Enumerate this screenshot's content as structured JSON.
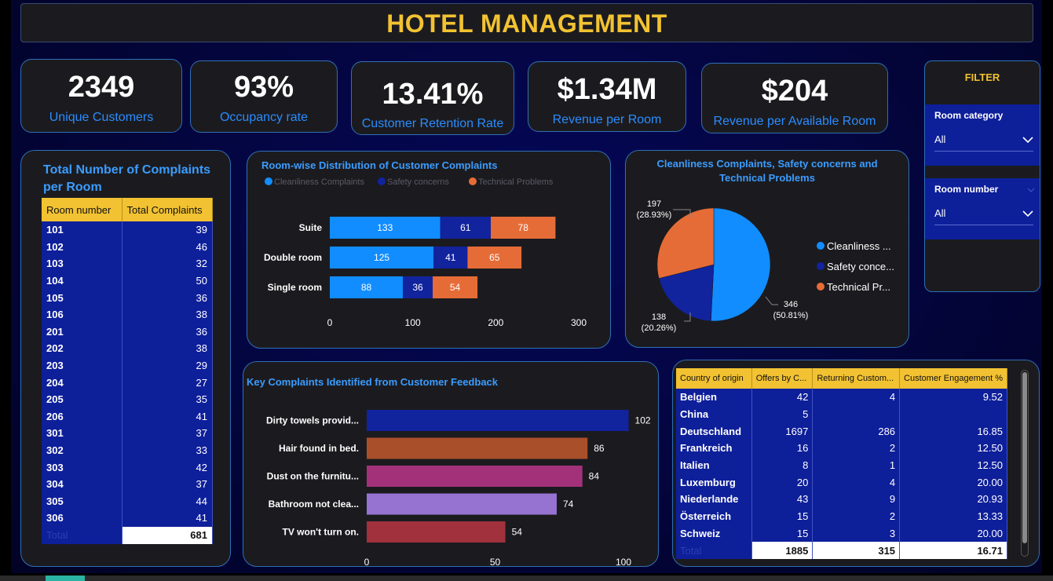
{
  "header": {
    "title": "HOTEL MANAGEMENT"
  },
  "kpis": [
    {
      "value": "2349",
      "label": "Unique Customers"
    },
    {
      "value": "93%",
      "label": "Occupancy rate"
    },
    {
      "value": "13.41%",
      "label": "Customer Retention Rate"
    },
    {
      "value": "$1.34M",
      "label": "Revenue per Room"
    },
    {
      "value": "$204",
      "label": "Revenue per Available Room"
    }
  ],
  "filter": {
    "title": "FILTER",
    "room_category": {
      "label": "Room category",
      "value": "All"
    },
    "room_number": {
      "label": "Room number",
      "value": "All"
    }
  },
  "complaints_table": {
    "title": "Total Number of Complaints per Room",
    "headers": [
      "Room number",
      "Total Complaints"
    ],
    "rows": [
      [
        "101",
        "39"
      ],
      [
        "102",
        "46"
      ],
      [
        "103",
        "32"
      ],
      [
        "104",
        "50"
      ],
      [
        "105",
        "36"
      ],
      [
        "106",
        "38"
      ],
      [
        "201",
        "36"
      ],
      [
        "202",
        "38"
      ],
      [
        "203",
        "29"
      ],
      [
        "204",
        "27"
      ],
      [
        "205",
        "35"
      ],
      [
        "206",
        "41"
      ],
      [
        "301",
        "37"
      ],
      [
        "302",
        "33"
      ],
      [
        "303",
        "42"
      ],
      [
        "304",
        "37"
      ],
      [
        "305",
        "44"
      ],
      [
        "306",
        "41"
      ]
    ],
    "total_label": "Total",
    "total_value": "681"
  },
  "country_table": {
    "headers": [
      "Country of origin",
      "Offers by C...",
      "Returning Custom...",
      "Customer Engagement %"
    ],
    "rows": [
      [
        "Belgien",
        "42",
        "4",
        "9.52"
      ],
      [
        "China",
        "5",
        "",
        ""
      ],
      [
        "Deutschland",
        "1697",
        "286",
        "16.85"
      ],
      [
        "Frankreich",
        "16",
        "2",
        "12.50"
      ],
      [
        "Italien",
        "8",
        "1",
        "12.50"
      ],
      [
        "Luxemburg",
        "20",
        "4",
        "20.00"
      ],
      [
        "Niederlande",
        "43",
        "9",
        "20.93"
      ],
      [
        "Österreich",
        "15",
        "2",
        "13.33"
      ],
      [
        "Schweiz",
        "15",
        "3",
        "20.00"
      ]
    ],
    "total": [
      "Total",
      "1885",
      "315",
      "16.71"
    ]
  },
  "chart_data": [
    {
      "type": "bar",
      "orientation": "horizontal",
      "stacked": true,
      "title": "Room-wise Distribution of Customer Complaints",
      "categories": [
        "Suite",
        "Double room",
        "Single room"
      ],
      "series": [
        {
          "name": "Cleanliness Complaints",
          "values": [
            133,
            125,
            88
          ],
          "color": "#118dff"
        },
        {
          "name": "Safety concerns",
          "values": [
            61,
            41,
            36
          ],
          "color": "#12239e"
        },
        {
          "name": "Technical Problems",
          "values": [
            78,
            65,
            54
          ],
          "color": "#e66c37"
        }
      ],
      "xlim": [
        0,
        300
      ],
      "xticks": [
        "0",
        "100",
        "200",
        "300"
      ],
      "legend": "top"
    },
    {
      "type": "pie",
      "title": "Cleanliness Complaints, Safety concerns and Technical Problems",
      "slices": [
        {
          "name": "Cleanliness ...",
          "value": 346,
          "label": "346",
          "pct": "(50.81%)",
          "color": "#118dff"
        },
        {
          "name": "Safety conce...",
          "value": 138,
          "label": "138",
          "pct": "(20.26%)",
          "color": "#12239e"
        },
        {
          "name": "Technical Pr...",
          "value": 197,
          "label": "197",
          "pct": "(28.93%)",
          "color": "#e66c37"
        }
      ],
      "legend": "right"
    },
    {
      "type": "bar",
      "orientation": "horizontal",
      "title": "Key Complaints Identified from Customer Feedback",
      "categories": [
        "Dirty towels provid...",
        "Hair found in bed.",
        "Dust on the furnitu...",
        "Bathroom not clea...",
        "TV won't turn on."
      ],
      "values": [
        102,
        86,
        84,
        74,
        54
      ],
      "colors": [
        "#12239e",
        "#a94f2a",
        "#a3317a",
        "#9673d1",
        "#a0313d"
      ],
      "xlim": [
        0,
        100
      ],
      "xticks": [
        "0",
        "50",
        "100"
      ]
    }
  ]
}
